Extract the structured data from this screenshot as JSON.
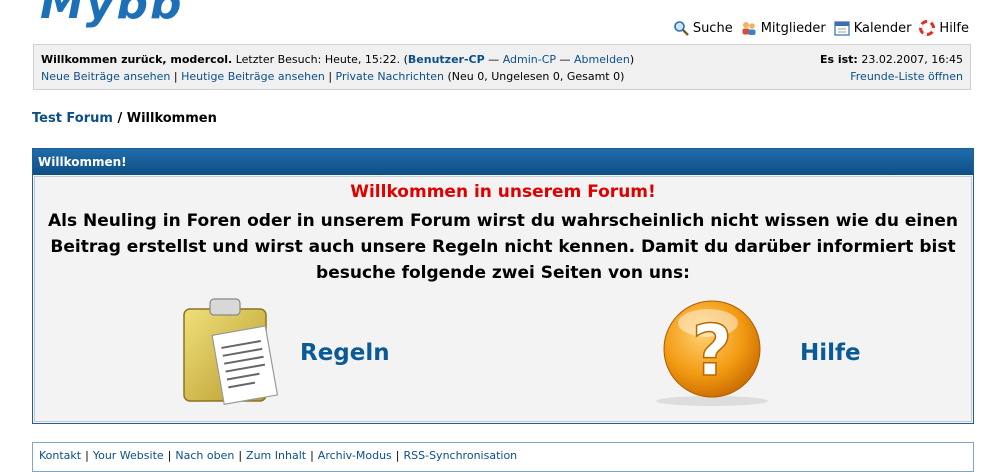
{
  "logo": {
    "text": "Mybb"
  },
  "topnav": {
    "items": [
      {
        "label": "Suche",
        "icon": "search-icon"
      },
      {
        "label": "Mitglieder",
        "icon": "members-icon"
      },
      {
        "label": "Kalender",
        "icon": "calendar-icon"
      },
      {
        "label": "Hilfe",
        "icon": "help-icon"
      }
    ]
  },
  "welcome_panel": {
    "greeting": "Willkommen zurück, modercol.",
    "last_visit": " Letzter Besuch: Heute, 15:22. (",
    "user_cp": "Benutzer-CP",
    "dash1": " — ",
    "admin_cp": "Admin-CP",
    "dash2": " — ",
    "logout": "Abmelden",
    "close_paren": ")",
    "date_label": "Es ist:",
    "date_value": " 23.02.2007, 16:45",
    "new_posts": "Neue Beiträge ansehen",
    "today_posts": "Heutige Beiträge ansehen",
    "private_messages": "Private Nachrichten",
    "pm_counts": " (Neu 0, Ungelesen 0, Gesamt 0)",
    "buddy_list": "Freunde-Liste öffnen"
  },
  "breadcrumb": {
    "forum": "Test Forum",
    "separator": " / ",
    "current": "Willkommen"
  },
  "box": {
    "header": "Willkommen!",
    "title": "Willkommen in unserem Forum!",
    "text": "Als Neuling in Foren oder in unserem Forum wirst du wahrscheinlich nicht wissen wie du einen Beitrag erstellst und wirst auch unsere Regeln nicht kennen. Damit du darüber informiert bist besuche folgende zwei Seiten von uns:",
    "rules_label": "Regeln",
    "help_label": "Hilfe"
  },
  "footer": {
    "links": [
      "Kontakt",
      "Your Website",
      "Nach oben",
      "Zum Inhalt",
      "Archiv-Modus",
      "RSS-Synchronisation"
    ]
  },
  "colors": {
    "header_blue": "#1f6cab",
    "link_blue": "#0b4f8a",
    "welcome_red": "#e00000"
  }
}
